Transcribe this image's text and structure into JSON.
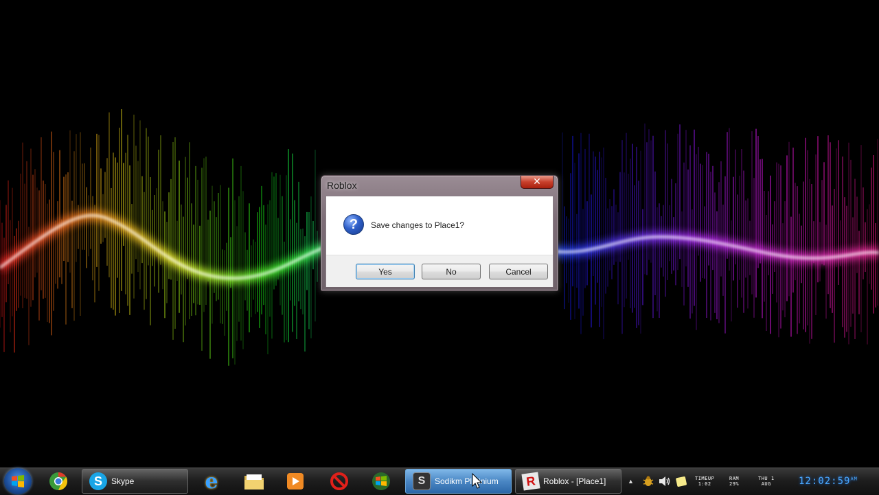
{
  "dialog": {
    "title": "Roblox",
    "close_glyph": "✕",
    "message": "Save changes to Place1?",
    "icon": "question-icon",
    "buttons": {
      "yes": "Yes",
      "no": "No",
      "cancel": "Cancel"
    }
  },
  "taskbar": {
    "start_icon": "windows-start-icon",
    "pinned": [
      {
        "name": "chrome-icon"
      },
      {
        "name": "internet-explorer-icon"
      },
      {
        "name": "file-explorer-icon"
      },
      {
        "name": "media-player-icon"
      },
      {
        "name": "no-entry-icon"
      },
      {
        "name": "windows-icon"
      }
    ],
    "tasks": [
      {
        "name": "skype-task",
        "label": "Skype",
        "active": false
      },
      {
        "name": "sodikm-task",
        "label": "Sodikm Platinium",
        "active": true
      },
      {
        "name": "roblox-task",
        "label": "Roblox - [Place1]",
        "active": false
      }
    ]
  },
  "tray": {
    "timeup_label": "TIMEUP",
    "timeup_value": "1:02",
    "ram_label": "RAM",
    "ram_value": "29%",
    "day": "THU",
    "date_day": "1",
    "month": "AUG",
    "clock": "12:02:59",
    "clock_ampm": "AM"
  },
  "colors": {
    "clock": "#4aa8ff",
    "active_task": "#4a87c4",
    "wave_left": "#ff3a2a",
    "wave_mid": "#3aff2a",
    "wave_right": "#ff2adf"
  }
}
